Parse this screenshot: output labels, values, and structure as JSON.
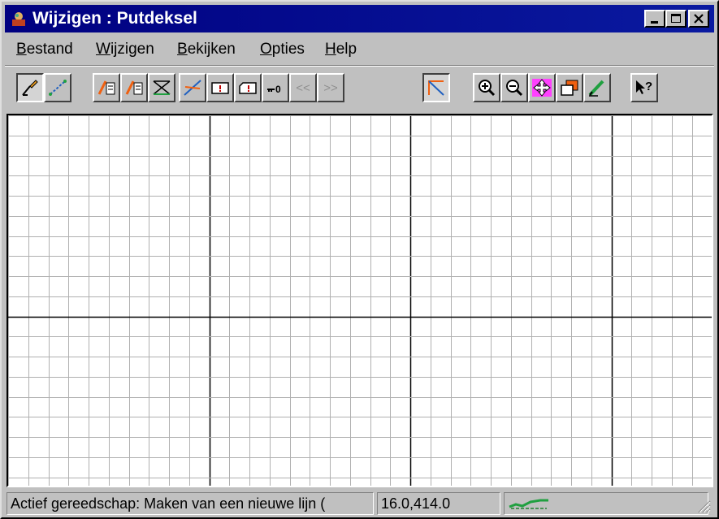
{
  "window": {
    "title": "Wijzigen : Putdeksel"
  },
  "title_buttons": {
    "minimize": "minimize-icon",
    "maximize": "maximize-icon",
    "close": "close-icon"
  },
  "menu": [
    {
      "u": "B",
      "rest": "estand"
    },
    {
      "u": "W",
      "rest": "ijzigen"
    },
    {
      "u": "B",
      "rest": "ekijken"
    },
    {
      "u": "O",
      "rest": "pties"
    },
    {
      "u": "H",
      "rest": "elp"
    }
  ],
  "toolbar": {
    "tools": [
      "draw-line-icon",
      "move-points-icon",
      "copy-left-icon",
      "copy-right-icon",
      "intersect-icon",
      "extend-line-icon",
      "text-box-icon",
      "label-box-icon",
      "key-icon",
      "previous-icon",
      "next-icon",
      "angle-icon",
      "zoom-in-icon",
      "zoom-out-icon",
      "pan-icon",
      "window-icon",
      "pen-icon",
      "help-pointer-icon"
    ],
    "next_label": ">>",
    "prev_label": "<<"
  },
  "status": {
    "message": "Actief gereedschap: Maken van een nieuwe lijn (",
    "coordinates": "16.0,414.0",
    "indicator": "progress-icon"
  },
  "colors": {
    "titlebar": "#000080",
    "grid_minor": "#b0b0b0",
    "grid_major": "#000000"
  }
}
